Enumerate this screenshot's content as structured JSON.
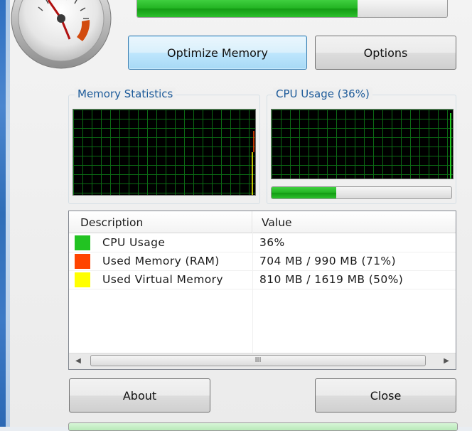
{
  "top_progress": {
    "percent": 71
  },
  "buttons": {
    "optimize": "Optimize Memory",
    "options": "Options",
    "about": "About",
    "close": "Close"
  },
  "memory_stats": {
    "title": "Memory Statistics"
  },
  "cpu_usage": {
    "title": "CPU Usage (36%)",
    "percent": 36
  },
  "table": {
    "headers": [
      "Description",
      "Value"
    ],
    "rows": [
      {
        "color": "#22c322",
        "description": "CPU Usage",
        "value": "36%"
      },
      {
        "color": "#ff4400",
        "description": "Used Memory (RAM)",
        "value": "704 MB / 990 MB (71%)"
      },
      {
        "color": "#ffff00",
        "description": "Used Virtual Memory",
        "value": "810 MB / 1619 MB (50%)"
      }
    ],
    "scroll_grip": "III"
  },
  "colors": {
    "accent_title": "#1c5a99",
    "progress_green": "#22b322",
    "graph_grid": "#0b6b14"
  }
}
